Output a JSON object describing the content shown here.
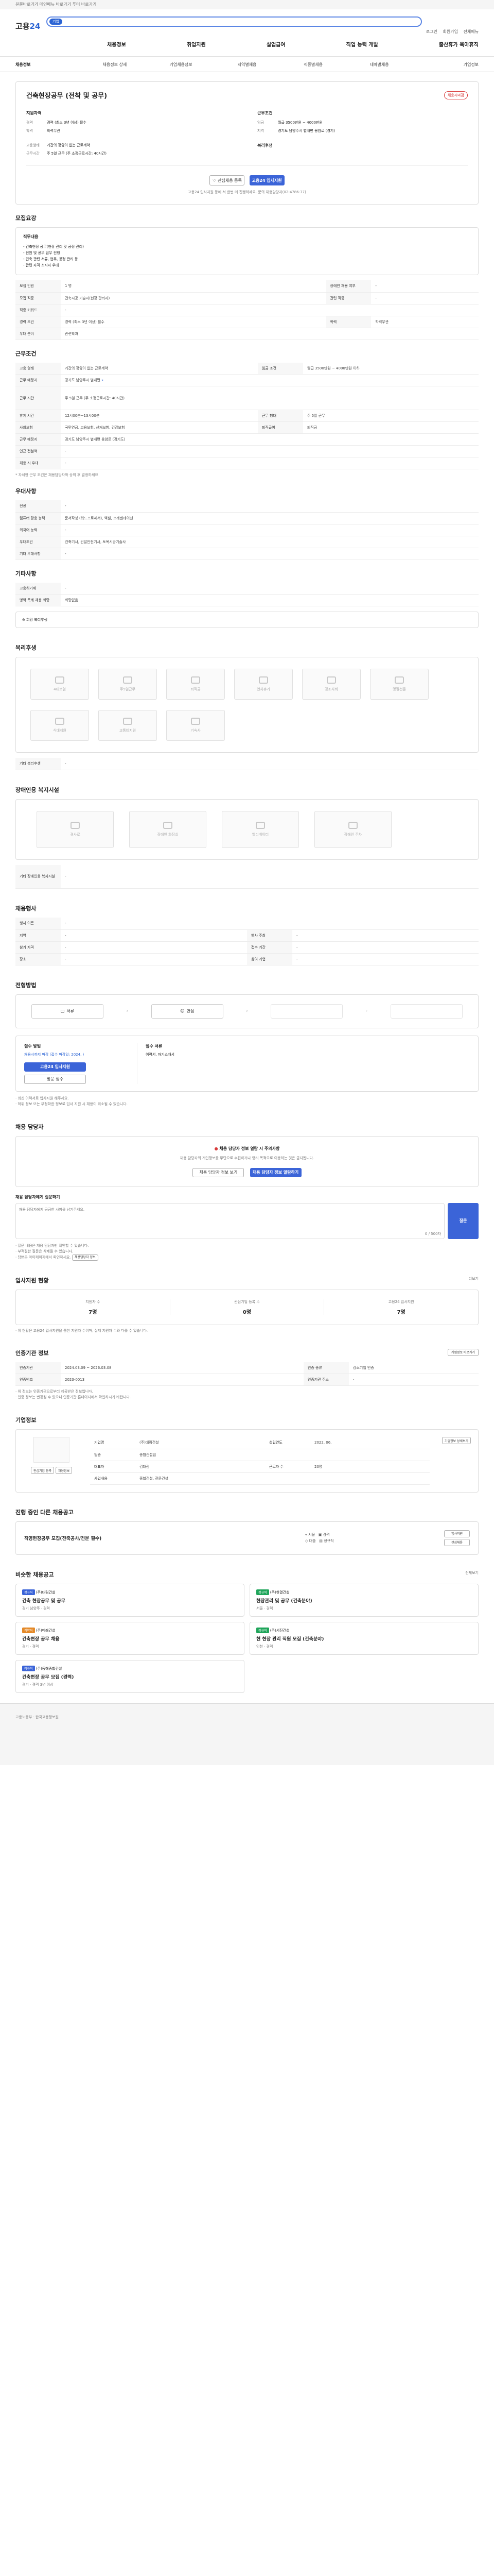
{
  "topbar": {
    "text": "본문바로가기 메인메뉴 바로가기 푸터 바로가기"
  },
  "header": {
    "logo_prefix": "고용",
    "logo_num": "24",
    "search_tag": "기업",
    "utils": [
      "로그인",
      "회원가입",
      "전체메뉴"
    ],
    "menu": [
      "채용정보",
      "취업지원",
      "실업급여",
      "직업 능력 개발",
      "출산휴가 육아휴직"
    ]
  },
  "lnb": [
    "채용정보",
    "채용정보 상세",
    "기업채용정보",
    "지역별채용",
    "직종별채용",
    "테마별채용",
    "기업정보"
  ],
  "job": {
    "title": "건축현장공무 (전착 및 공무)",
    "badge": "채용시마감",
    "summary": [
      {
        "k": "지원자격",
        "v": ""
      },
      {
        "k": "경력",
        "v": "경력 (최소 3년 이상) 필수"
      },
      {
        "k": "학력",
        "v": "학력무관"
      },
      {
        "k": "고용형태",
        "v": "기간의 정함이 없는 근로계약"
      },
      {
        "k": "근무시간",
        "v": "주 5일 근무 (주 소정근로시간: 40시간)"
      }
    ],
    "conditions": [
      {
        "k": "근무조건",
        "v": ""
      },
      {
        "k": "임금",
        "v": "월급 3500만원 ~ 4000만원"
      },
      {
        "k": "지역",
        "v": "경기도 남양주시 별내면 용암로 (경기)"
      },
      {
        "k": "복리후생",
        "v": ""
      }
    ],
    "buttons": {
      "save": "관심채용 등록",
      "apply": "고용24 입사지원"
    },
    "notice": "고용24 입사지원 등에 서 한번 더 진행하세요. 문의 채용담당자(02-4786-77)"
  },
  "recruit": {
    "heading": "모집요강",
    "duty_title": "직무내용",
    "duties": [
      "- 건축현장 공무(현장 관리 및 공정 관리)",
      "- 전원 및 공무 업무 진행",
      "- 건축 관련 서류, 업무, 공정 관리 등",
      "- 관련 자격 소지자 우대"
    ],
    "rows": [
      {
        "k": "모집 인원",
        "v": "1 명",
        "k2": "장애인 채용 여부",
        "v2": "-"
      },
      {
        "k": "모집 직종",
        "v": "건축시공 기술자(현장 관리자)",
        "k2": "관련 직종",
        "v2": "-"
      },
      {
        "k": "직종 키워드",
        "v": "-",
        "k2": "",
        "v2": ""
      },
      {
        "k": "경력 조건",
        "v": "경력 (최소 3년 이상) 필수",
        "k2": "학력",
        "v2": "학력무관"
      },
      {
        "k": "우대 분야",
        "v": "관련학과",
        "k2": "",
        "v2": ""
      }
    ]
  },
  "workcond": {
    "heading": "근무조건",
    "rows": [
      {
        "k": "고용 형태",
        "v": "기간의 정함이 없는 근로계약",
        "k2": "임금 조건",
        "v2": "월급 3500만원 ~ 4000만원 이하"
      },
      {
        "k": "근무 예정지",
        "v": "경기도 남양주시 별내면",
        "k2": "",
        "v2": ""
      },
      {
        "k": "근무 시간",
        "v": "주 5일 근무 (주 소정근로시간: 40시간)",
        "k2": "",
        "v2": ""
      },
      {
        "k": "휴게 시간",
        "v": "12시00분~13시00분",
        "k2": "근무 형태",
        "v2": "주 5일 근무"
      },
      {
        "k": "사회보험",
        "v": "국민연금, 고용보험, 산재보험, 건강보험",
        "k2": "퇴직급여",
        "v2": "퇴직금"
      },
      {
        "k": "근무 예정지",
        "v": "경기도 남양주시 별내면 용암로 (경기도)",
        "k2": "",
        "v2": ""
      },
      {
        "k": "인근 전철역",
        "v": "-",
        "k2": "",
        "v2": ""
      },
      {
        "k": "채용 시 우대",
        "v": "-",
        "k2": "",
        "v2": ""
      }
    ],
    "note": "* 자세한 근무 조건은 채용담당자와 상의 후 결정하세요"
  },
  "prefs": {
    "heading": "우대사항",
    "rows": [
      {
        "k": "전공",
        "v": "-"
      },
      {
        "k": "컴퓨터 활용 능력",
        "v": "문서작성 (워드프로세서), 엑셀, 프레젠테이션"
      },
      {
        "k": "외국어 능력",
        "v": "-"
      },
      {
        "k": "우대조건",
        "v": "건축기사, 건설안전기사, 토목시공기술사"
      },
      {
        "k": "기타 우대사항",
        "v": "-"
      }
    ]
  },
  "etc": {
    "heading": "기타사항",
    "rows": [
      {
        "k": "고용허가제",
        "v": "-"
      },
      {
        "k": "병역 특례 채용 희망",
        "v": "희망없음"
      }
    ],
    "wrap": "희망 복리후생"
  },
  "welfare": {
    "heading": "복리후생",
    "items": [
      "4대보험",
      "주5일근무",
      "퇴직금",
      "연차휴가",
      "경조사비",
      "명절선물",
      "식대지원",
      "교통비지원",
      "기숙사"
    ],
    "foot_k": "기타 복리후생",
    "foot_v": "-"
  },
  "disab": {
    "heading": "장애인용 복지시설",
    "items": [
      "경사로",
      "장애인 화장실",
      "엘리베이터",
      "장애인 주차"
    ],
    "foot_k": "기타 장애인용 복지시설",
    "foot_v": "-"
  },
  "place": {
    "heading": "채용행사",
    "rows": [
      {
        "k": "행사 이름",
        "v": "-",
        "k2": "",
        "v2": ""
      },
      {
        "k": "지역",
        "v": "-",
        "k2": "행사 주최",
        "v2": "-"
      },
      {
        "k": "참가 자격",
        "v": "-",
        "k2": "접수 기간",
        "v2": "-"
      },
      {
        "k": "장소",
        "v": "-",
        "k2": "참여 기업",
        "v2": "-"
      }
    ]
  },
  "process": {
    "heading": "전형방법",
    "steps": [
      "서류",
      "면접",
      "",
      ""
    ],
    "apply_title": "접수 방법",
    "apply_v": "채용시까지 마감 (접수 마감일: 2024. )",
    "apply_btn": "고용24 입사지원",
    "apply_btn2": "방문 접수",
    "submit_title": "접수 서류",
    "submit_v": "이력서, 자기소개서",
    "notes": [
      "· 최신 이력서로 입사지원 해주세요.",
      "· 허위 정보 또는 부정확한 정보로 입사 지원 시 채용이 취소될 수 있습니다."
    ]
  },
  "contact": {
    "heading": "채용 담당자",
    "badge": "채용 담당자 정보 열람 시 주의사항",
    "desc": "채용 담당자의 개인정보를 무단으로 수집하거나 영리 목적으로 이용하는 것은 금지됩니다.",
    "btn1": "채용 담당자 정보 보기",
    "btn2": "채용 담당자 정보 열람하기",
    "q_title": "채용 담당자에게 질문하기",
    "q_placeholder": "채용 담당자에게 궁금한 사항을 남겨주세요.",
    "q_count": "0 / 500자",
    "q_btn": "질문",
    "q_notes": [
      "· 질문 내용은 채용 담당자만 확인할 수 있습니다.",
      "· 부적절한 질문은 삭제될 수 있습니다.",
      "· 답변은 마이페이지에서 확인하세요."
    ],
    "q_link": "채용담당자 정보"
  },
  "stats": {
    "heading": "입사지원 현황",
    "more": "더보기",
    "items": [
      {
        "label": "지원자 수",
        "value": "7명"
      },
      {
        "label": "관심기업 등록 수",
        "value": "0명"
      },
      {
        "label": "고용24 입사지원",
        "value": "7명"
      }
    ],
    "note": "· 위 현황은 고용24 입사지원을 통한 지원자 수이며, 실제 지원자 수와 다를 수 있습니다."
  },
  "org": {
    "heading": "인증기관 정보",
    "btn": "기업정보 바로가기",
    "rows": [
      {
        "k": "인증기관",
        "v": "2024.03.09 ~ 2026.03.08",
        "k2": "인증 종류",
        "v2": "강소기업 인증"
      },
      {
        "k": "인증번호",
        "v": "2023-0013",
        "k2": "인증기관 주소",
        "v2": "-"
      }
    ],
    "notes": [
      "· 위 정보는 인증기관으로부터 제공받은 정보입니다.",
      "· 인증 정보는 변경될 수 있으니 인증기관 홈페이지에서 확인하시기 바랍니다."
    ]
  },
  "company": {
    "heading": "기업정보",
    "name": "(주)대림건설",
    "btns": [
      "관심기업 등록",
      "채용정보"
    ],
    "rows": [
      {
        "k": "기업명",
        "v": "(주)대림건설",
        "k2": "설립연도",
        "v2": "2022. 06."
      },
      {
        "k": "업종",
        "v": "종합건설업",
        "k2": "",
        "v2": ""
      },
      {
        "k": "대표자",
        "v": "김대림",
        "k2": "근로자 수",
        "v2": "20명"
      },
      {
        "k": "사업내용",
        "v": "종합건설, 전문건설",
        "k2": "",
        "v2": ""
      }
    ],
    "detail_btn": "기업정보 상세보기"
  },
  "inprog": {
    "heading": "진행 중인 다른 채용공고",
    "title": "직영현장공무 모집(전축공사/전문 필수)",
    "tags": [
      "서울",
      "경력",
      "대졸",
      "정규직"
    ],
    "btns": [
      "입사지원",
      "관심채용"
    ]
  },
  "similar": {
    "heading": "비슷한 채용공고",
    "more": "전체보기",
    "items": [
      {
        "badge": "정규직",
        "company": "(주)대림건설",
        "title": "건축 현장공무 및 공무",
        "meta": "경기 남양주 · 경력"
      },
      {
        "badge": "정규직",
        "company": "(주)한결건설",
        "title": "현장관리 및 공무 (건축분야)",
        "meta": "서울 · 경력"
      },
      {
        "badge": "계약직",
        "company": "(주)미래건설",
        "title": "건축현장 공무 채용",
        "meta": "경기 · 경력"
      },
      {
        "badge": "정규직",
        "company": "(주)서진건설",
        "title": "현 현장 관리 직원 모집 (건축분야)",
        "meta": "인천 · 경력"
      },
      {
        "badge": "정규직",
        "company": "(주)동해종합건설",
        "title": "건축현장 공무 모집 (경력)",
        "meta": "경기 · 경력 3년 이상"
      }
    ]
  },
  "footer": {
    "text": "고용노동부 · 한국고용정보원"
  }
}
